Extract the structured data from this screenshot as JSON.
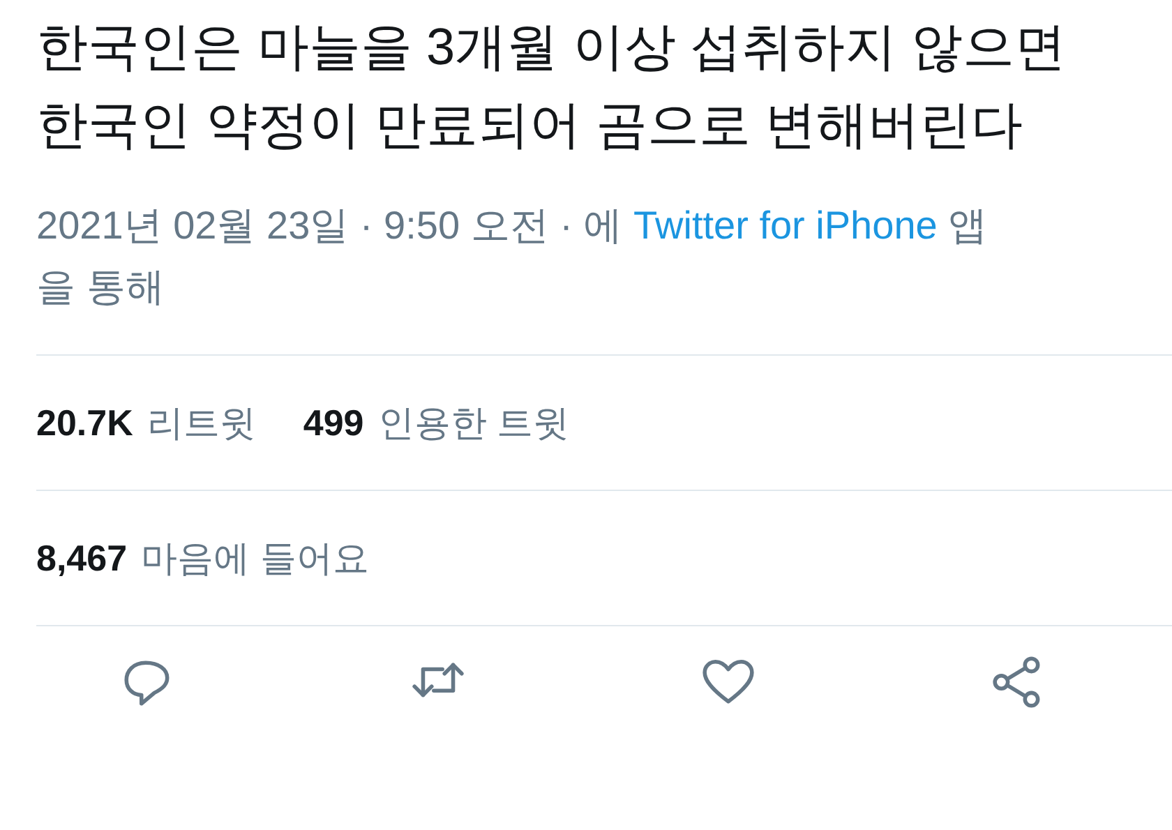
{
  "tweet": {
    "text": "한국인은 마늘을 3개월 이상 섭취하지 않으면 한국인 약정이 만료되어 곰으로 변해버린다",
    "meta_before": "2021년 02월 23일 · 9:50 오전 · 에",
    "source_link": "Twitter for iPhone",
    "meta_after": "앱을 통해"
  },
  "stats": [
    {
      "count": "20.7K",
      "label": "리트윗"
    },
    {
      "count": "499",
      "label": "인용한 트윗"
    }
  ],
  "likes": {
    "count": "8,467",
    "label": "마음에 들어요"
  },
  "actions": [
    {
      "kind": "reply"
    },
    {
      "kind": "retweet"
    },
    {
      "kind": "like"
    },
    {
      "kind": "share"
    }
  ]
}
